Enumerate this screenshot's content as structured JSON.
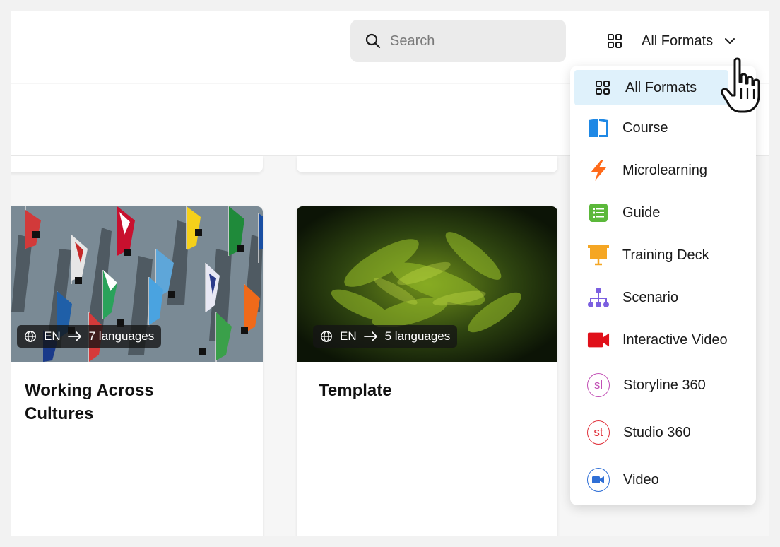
{
  "search": {
    "placeholder": "Search",
    "icon": "search-icon"
  },
  "format_select": {
    "label": "All Formats",
    "icon": "grid-icon"
  },
  "cards": [
    {
      "title": "Working Across Cultures",
      "source_lang": "EN",
      "languages": "7 languages"
    },
    {
      "title": "Template",
      "source_lang": "EN",
      "languages": "5 languages"
    }
  ],
  "menu": {
    "items": [
      {
        "label": "All Formats",
        "icon": "grid-icon",
        "selected": true
      },
      {
        "label": "Course",
        "icon": "book-icon",
        "color": "#1e88e5"
      },
      {
        "label": "Microlearning",
        "icon": "lightning-icon",
        "color": "#ff6a1a"
      },
      {
        "label": "Guide",
        "icon": "list-icon",
        "color": "#5bb83a"
      },
      {
        "label": "Training Deck",
        "icon": "presentation-icon",
        "color": "#f5a623"
      },
      {
        "label": "Scenario",
        "icon": "org-chart-icon",
        "color": "#7b5fe0"
      },
      {
        "label": "Interactive Video",
        "icon": "video-camera-icon",
        "color": "#e0101a"
      },
      {
        "label": "Storyline 360",
        "icon": "storyline-icon",
        "badge": "sl",
        "color": "#c24fb5"
      },
      {
        "label": "Studio 360",
        "icon": "studio-icon",
        "badge": "st",
        "color": "#e0303a"
      },
      {
        "label": "Video",
        "icon": "video-icon",
        "color": "#2f6fd6"
      }
    ]
  }
}
